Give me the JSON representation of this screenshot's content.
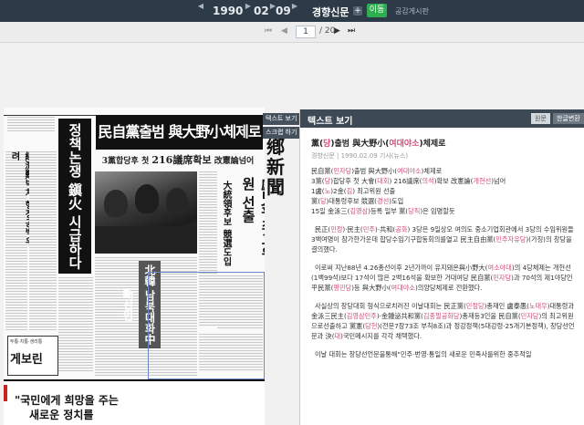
{
  "toolbar": {
    "year": "1990",
    "month": "02",
    "day": "09",
    "publication": "경향신문",
    "plus": "+",
    "go_label": "이동",
    "board_link": "공감게시판",
    "prev_icon": "triangle-left-icon",
    "next_icon": "triangle-right-icon"
  },
  "pager": {
    "current_page": "1",
    "total": "/ 20",
    "first": "⏮",
    "prev": "◀",
    "next": "▶",
    "last": "⏭"
  },
  "side_tabs": [
    "텍스트 보기",
    "스크랩 하기"
  ],
  "newspaper": {
    "headline": "民自黨출범 與大野小체제로",
    "subhead_prefix": "3黨합당후 첫",
    "subhead_bold": "216議席확보",
    "subhead_suffix": " 改憲論넘어",
    "vertical_1": "정책논쟁 鎭火 시급하다",
    "vertical_2": "盧2金 최고위원 선출",
    "vertical_3": "大統領후보 競選도입",
    "vertical_4": "北韓 남북대화中斷선언",
    "masthead": "鄕新聞",
    "ad_small": "두통·치통·생리통",
    "ad_big": "게보린",
    "bottom_ad_1": "\"국민에게 희망을 주는",
    "bottom_ad_2": "새로운 정치를"
  },
  "panel": {
    "title": "텍스트 보기",
    "tab_original": "원문",
    "tab_converted": "한글변환",
    "article_title_pre": "黨(",
    "article_title_parts": [
      {
        "t": "黨(",
        "hl": false
      },
      {
        "t": "당",
        "hl": true
      },
      {
        "t": ")출범 與大野小(",
        "hl": false
      },
      {
        "t": "여대야소",
        "hl": true
      },
      {
        "t": ")체제로",
        "hl": false
      }
    ],
    "article_meta": "경향신문 | 1990.02.09 기사(뉴스)",
    "lead_lines": [
      [
        {
          "t": "民自黨(",
          "hl": false
        },
        {
          "t": "민자당",
          "hl": true
        },
        {
          "t": ")출범 與大野小(",
          "hl": false
        },
        {
          "t": "여대야소",
          "hl": true
        },
        {
          "t": ")체제로",
          "hl": false
        }
      ],
      [
        {
          "t": "3黨(",
          "hl": false
        },
        {
          "t": "당",
          "hl": true
        },
        {
          "t": ")합당후 첫 大會(",
          "hl": false
        },
        {
          "t": "대회",
          "hl": true
        },
        {
          "t": ") 216議席(",
          "hl": false
        },
        {
          "t": "의석",
          "hl": true
        },
        {
          "t": ")확보 改憲論(",
          "hl": false
        },
        {
          "t": "개헌선",
          "hl": true
        },
        {
          "t": ")넘어",
          "hl": false
        }
      ],
      [
        {
          "t": "1盧(",
          "hl": false
        },
        {
          "t": "노",
          "hl": true
        },
        {
          "t": ")2金(",
          "hl": false
        },
        {
          "t": "김",
          "hl": true
        },
        {
          "t": ") 최고위원 선출",
          "hl": false
        }
      ],
      [
        {
          "t": "黨(",
          "hl": false
        },
        {
          "t": "당",
          "hl": true
        },
        {
          "t": ")대통령후보 競選(",
          "hl": false
        },
        {
          "t": "경선",
          "hl": true
        },
        {
          "t": ")도입",
          "hl": false
        }
      ],
      [
        {
          "t": "15일 金泳三(",
          "hl": false
        },
        {
          "t": "김영삼",
          "hl": true
        },
        {
          "t": ")등록 일부 黨(",
          "hl": false
        },
        {
          "t": "당직",
          "hl": true
        },
        {
          "t": ")은 임명할듯",
          "hl": false
        }
      ]
    ],
    "paragraphs": [
      [
        {
          "t": "民正(",
          "hl": false
        },
        {
          "t": "민정",
          "hl": true
        },
        {
          "t": ")·民主(",
          "hl": false
        },
        {
          "t": "민주",
          "hl": true
        },
        {
          "t": ")·共和(",
          "hl": false
        },
        {
          "t": "공화",
          "hl": true
        },
        {
          "t": ") 3당은 9일상오 여의도 중소기업회관에서 3당의 수임위원들 3백여명이 참가한가운데 합당수임기구합동회의를열고 民主自由黨(",
          "hl": false
        },
        {
          "t": "민주자유당",
          "hl": true
        },
        {
          "t": ")(가칭)의 창당을결의했다.",
          "hl": false
        }
      ],
      [
        {
          "t": "이로써 지난88년 4.26총선이후 2년가까이 유지돼온與小野大(",
          "hl": false
        },
        {
          "t": "여소야대",
          "hl": true
        },
        {
          "t": ")의 4당체제는 개헌선(1백99석)보다 17석이 많은 2백16석을 확보한 거대여당 民自黨(",
          "hl": false
        },
        {
          "t": "민자당",
          "hl": true
        },
        {
          "t": ")과 70석의 제1야당인 平民黨(",
          "hl": false
        },
        {
          "t": "평민당",
          "hl": true
        },
        {
          "t": ")등 與大野小(",
          "hl": false
        },
        {
          "t": "여대야소",
          "hl": true
        },
        {
          "t": ")의양당체제로 전환했다.",
          "hl": false
        }
      ],
      [
        {
          "t": "사실상의 창당대회 형식으로치러진 이날대회는 民正黨(",
          "hl": false
        },
        {
          "t": "민정당",
          "hl": true
        },
        {
          "t": ")총재인 盧泰愚(",
          "hl": false
        },
        {
          "t": "노태우",
          "hl": true
        },
        {
          "t": ")대통령과 金泳三民主(",
          "hl": false
        },
        {
          "t": "김영삼민주",
          "hl": true
        },
        {
          "t": ")·金鍾泌共和黨(",
          "hl": false
        },
        {
          "t": "김종필공화당",
          "hl": true
        },
        {
          "t": ")총재등3인을 民自黨(",
          "hl": false
        },
        {
          "t": "민자당",
          "hl": true
        },
        {
          "t": ")의 최고위원으로선출하고 黨憲(",
          "hl": false
        },
        {
          "t": "당헌",
          "hl": true
        },
        {
          "t": ")(전문7장73조 부칙8조)과 정강정책(5대강령·25개기본정책), 창당선언문과 決(",
          "hl": false
        },
        {
          "t": "대",
          "hl": true
        },
        {
          "t": ")국민메시지를 각각 채택했다.",
          "hl": false
        }
      ],
      [
        {
          "t": "이날 대회는 창당선언문을통해\"민주·번영·통일의 새로운 민족사를위한 중추적일",
          "hl": false
        }
      ]
    ]
  }
}
